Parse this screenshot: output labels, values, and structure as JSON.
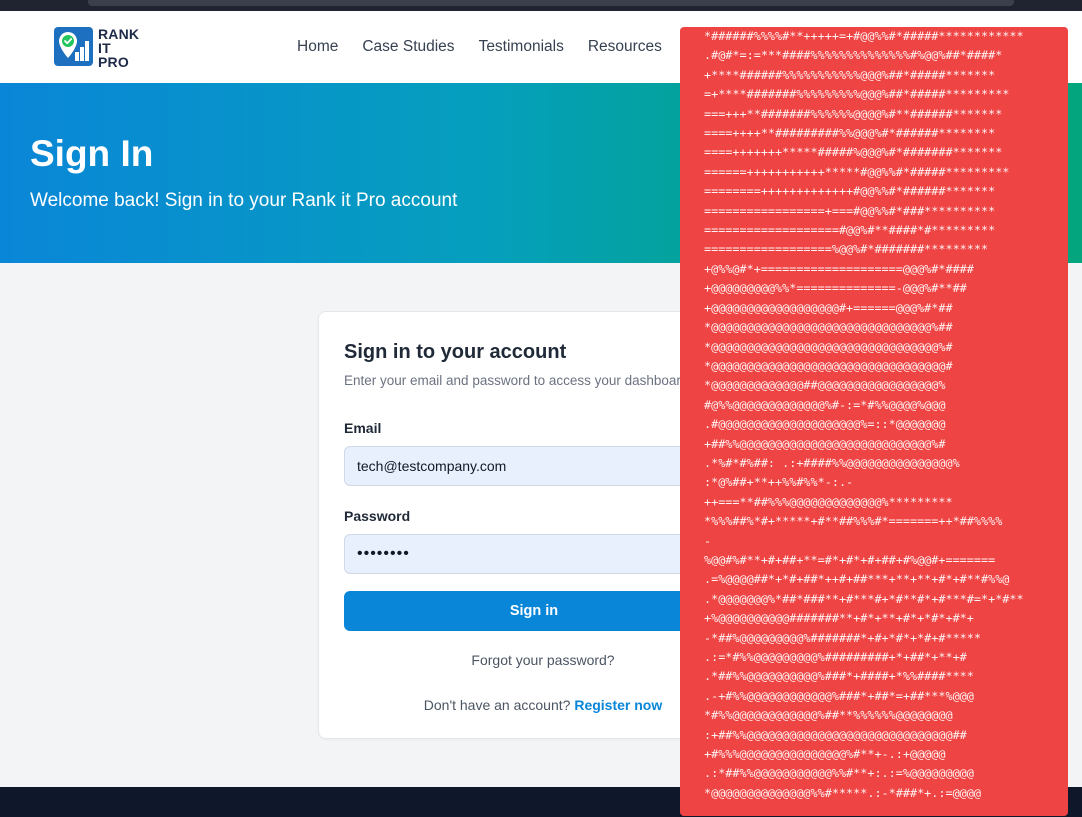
{
  "nav": {
    "logo_lines": [
      "RANK",
      "IT",
      "PRO"
    ],
    "links": [
      "Home",
      "Case Studies",
      "Testimonials",
      "Resources"
    ]
  },
  "hero": {
    "title": "Sign In",
    "subtitle": "Welcome back! Sign in to your Rank it Pro account"
  },
  "card": {
    "title": "Sign in to your account",
    "description": "Enter your email and password to access your dashboard",
    "email_label": "Email",
    "email_value": "tech@testcompany.com",
    "password_label": "Password",
    "password_value": "••••••••",
    "signin_label": "Sign in",
    "forgot_label": "Forgot your password?",
    "register_prompt": "Don't have an account?",
    "register_link": "Register now"
  },
  "overlay": {
    "ascii_art": "*######%%%%#**+++++=+#@@%%#*#####************\n.#@#*=:=***####%%%%%%%%%%%%%%#%@@%##*####*\n+****######%%%%%%%%%%%@@@%##*#####*******\n=+****#######%%%%%%%%%@@@%##*#####*********\n===+++**#######%%%%%%@@@@%#**######*******\n====++++**#########%%@@@%#*######********\n====+++++++*****#####%@@@%#*#######*******\n======+++++++++++*****#@@%%#*#####*********\n========+++++++++++++#@@%%#*######*******\n=================+===#@@%%#*###**********\n===================#@@%#**####*#*********\n==================%@@%#*#######*********\n+@%%@#*+====================@@@%#*####\n+@@@@@@@@@%%*==============-@@@%#**##\n+@@@@@@@@@@@@@@@@@@#+======@@@%#*##\n*@@@@@@@@@@@@@@@@@@@@@@@@@@@@@@@%##\n*@@@@@@@@@@@@@@@@@@@@@@@@@@@@@@@@%#\n*@@@@@@@@@@@@@@@@@@@@@@@@@@@@@@@@@#\n*@@@@@@@@@@@@@##@@@@@@@@@@@@@@@@@%\n#@%%@@@@@@@@@@@@@%#-:=*#%%@@@@%@@@\n.#@@@@@@@@@@@@@@@@@@@@%=::*@@@@@@@\n+##%%@@@@@@@@@@@@@@@@@@@@@@@@@@@%#\n.*%#*#%##: .:+####%%@@@@@@@@@@@@@@@%\n:*@%##+**++%%#%%*-:.-\n++===**##%%%@@@@@@@@@@@@@%*********\n*%%%##%*#+*****+#**##%%%#*=======++*##%%%%\n-\n%@@#%#**+#+##+**=#*+#*+#+##+#%@@#+=======\n.=%@@@@##*+*#+##*++#+##***+**+**+#*+#**#%%@\n.*@@@@@@@%*##*###**+#***#+*#**#*+#***#=*+*#**\n+%@@@@@@@@@@#######**+#*+**+#*+*#*+#*+\n-*##%@@@@@@@@@%#######*+#+*#*+*#+#*****\n.:=*#%%@@@@@@@@@%#########+*+##*+**+#\n.*##%%@@@@@@@@@@%###*+####+*%%####****\n.-+#%%@@@@@@@@@@@@%###*+##*=+##***%@@@\n*#%%@@@@@@@@@@@@%##**%%%%%%@@@@@@@@\n:+##%%@@@@@@@@@@@@@@@@@@@@@@@@@@@@@##\n+#%%%@@@@@@@@@@@@@@@%#**+-.:+@@@@@\n.:*##%%@@@@@@@@@@@%%#**+:.:=%@@@@@@@@@\n*@@@@@@@@@@@@@@%%#*****.:-*###*+.:=@@@@"
  },
  "colors": {
    "brand_blue": "#0a86d8",
    "hero_gradient_start": "#0a86d8",
    "hero_gradient_end": "#02a57e",
    "overlay_red": "#ef4444",
    "footer_dark": "#0f172a"
  },
  "icons": {
    "logo": "map-pin-check-chart-icon"
  }
}
